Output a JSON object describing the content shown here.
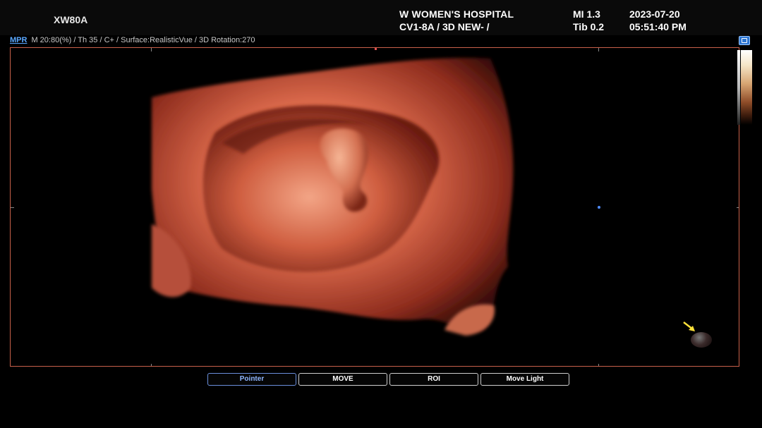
{
  "header": {
    "model": "XW80A",
    "hospital": "W WOMEN'S HOSPITAL",
    "probe_preset": "CV1-8A / 3D NEW- /",
    "mi": "MI  1.3",
    "tib": "Tib 0.2",
    "date": "2023-07-20",
    "time": "05:51:40 PM"
  },
  "infobar": {
    "mode_link": "MPR",
    "params": "M 20:80(%) / Th 35 / C+ / Surface:RealisticVue / 3D Rotation:270"
  },
  "toolbar": {
    "buttons": [
      {
        "label": "Pointer",
        "active": true
      },
      {
        "label": "MOVE",
        "active": false
      },
      {
        "label": "ROI",
        "active": false
      },
      {
        "label": "Move Light",
        "active": false
      }
    ]
  },
  "icons": {
    "settings": "settings-icon",
    "light_source": "light-source-icon",
    "arrow": "arrow-icon"
  },
  "colors": {
    "border": "#c8604a",
    "accent_blue": "#5aa8ff",
    "render_flesh": "#e07c5c"
  }
}
